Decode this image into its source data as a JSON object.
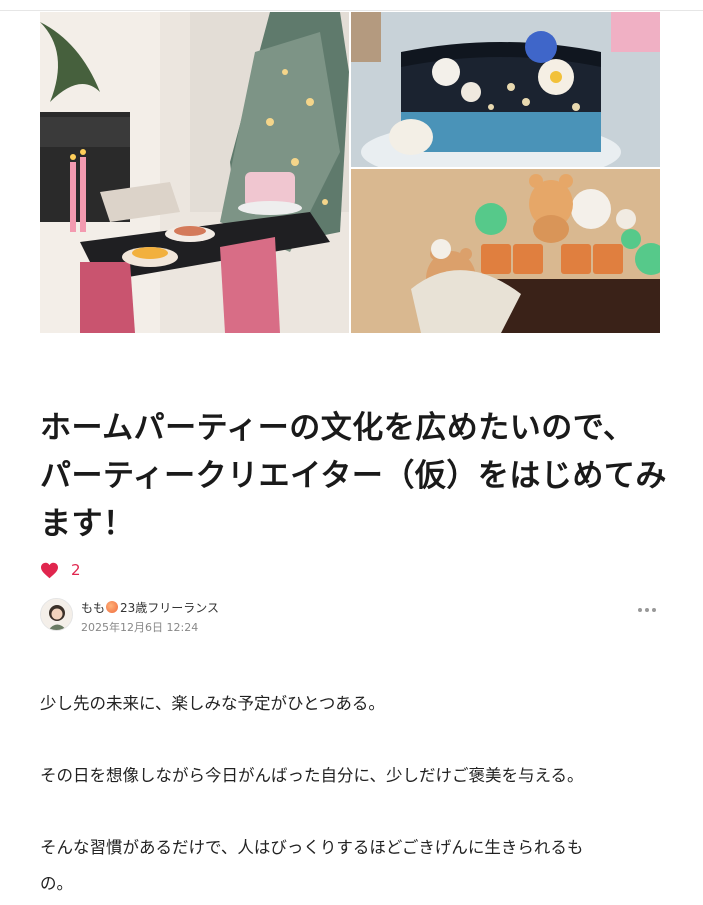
{
  "article": {
    "title_lines": [
      "ホームパーティーの文化を広めたいので、",
      "パーティークリエイター（仮）をはじめてみ",
      "ます！"
    ],
    "like_count": "2",
    "author_name_prefix": "もも",
    "author_name_suffix": "23歳フリーランス",
    "published": "2025年12月6日 12:24",
    "paragraphs": [
      "少し先の未来に、楽しみな予定がひとつある。",
      "その日を想像しながら今日がんばった自分に、少しだけご褒美を与える。"
    ],
    "paragraph3_lines": [
      "そんな習慣があるだけで、人はびっくりするほどごきげんに生きられるも",
      "の。"
    ]
  },
  "colors": {
    "accent_like": "#e0264e",
    "text": "#222222",
    "meta": "#888888"
  },
  "icons": {
    "like": "heart-icon",
    "more": "more-dots-icon",
    "author_emoji": "peach-icon"
  }
}
